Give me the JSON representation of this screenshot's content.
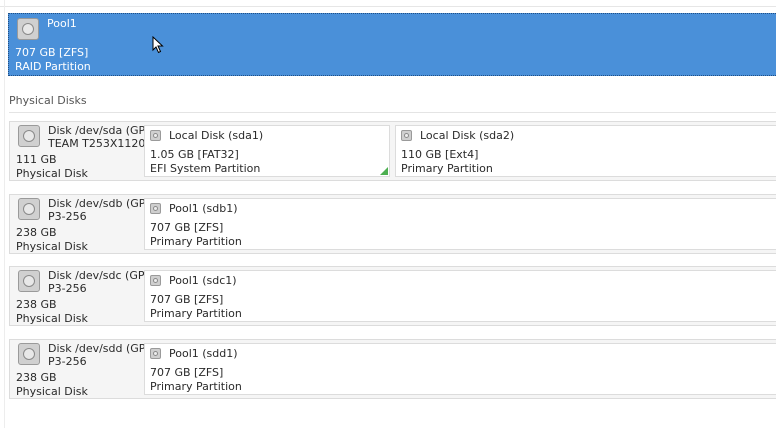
{
  "pool": {
    "name": "Pool1",
    "size": "707 GB [ZFS]",
    "kind": "RAID Partition",
    "icon": "hard-disk-icon",
    "selected_color": "#4a90d9"
  },
  "section": {
    "title": "Physical Disks"
  },
  "disks": [
    {
      "name_line1": "Disk /dev/sda (GPT",
      "name_line2": "TEAM T253X1120G",
      "size": "111 GB",
      "kind": "Physical Disk",
      "partitions": [
        {
          "name": "Local Disk (sda1)",
          "size": "1.05 GB [FAT32]",
          "kind": "EFI System Partition",
          "flag_color": "#4caf50"
        },
        {
          "name": "Local Disk (sda2)",
          "size": "110 GB [Ext4]",
          "kind": "Primary Partition"
        }
      ]
    },
    {
      "name_line1": "Disk /dev/sdb (GPT",
      "name_line2": "P3-256",
      "size": "238 GB",
      "kind": "Physical Disk",
      "partitions": [
        {
          "name": "Pool1 (sdb1)",
          "size": "707 GB [ZFS]",
          "kind": "Primary Partition"
        }
      ]
    },
    {
      "name_line1": "Disk /dev/sdc (GPT)",
      "name_line2": "P3-256",
      "size": "238 GB",
      "kind": "Physical Disk",
      "partitions": [
        {
          "name": "Pool1 (sdc1)",
          "size": "707 GB [ZFS]",
          "kind": "Primary Partition"
        }
      ]
    },
    {
      "name_line1": "Disk /dev/sdd (GPT",
      "name_line2": "P3-256",
      "size": "238 GB",
      "kind": "Physical Disk",
      "partitions": [
        {
          "name": "Pool1 (sdd1)",
          "size": "707 GB [ZFS]",
          "kind": "Primary Partition"
        }
      ]
    }
  ]
}
